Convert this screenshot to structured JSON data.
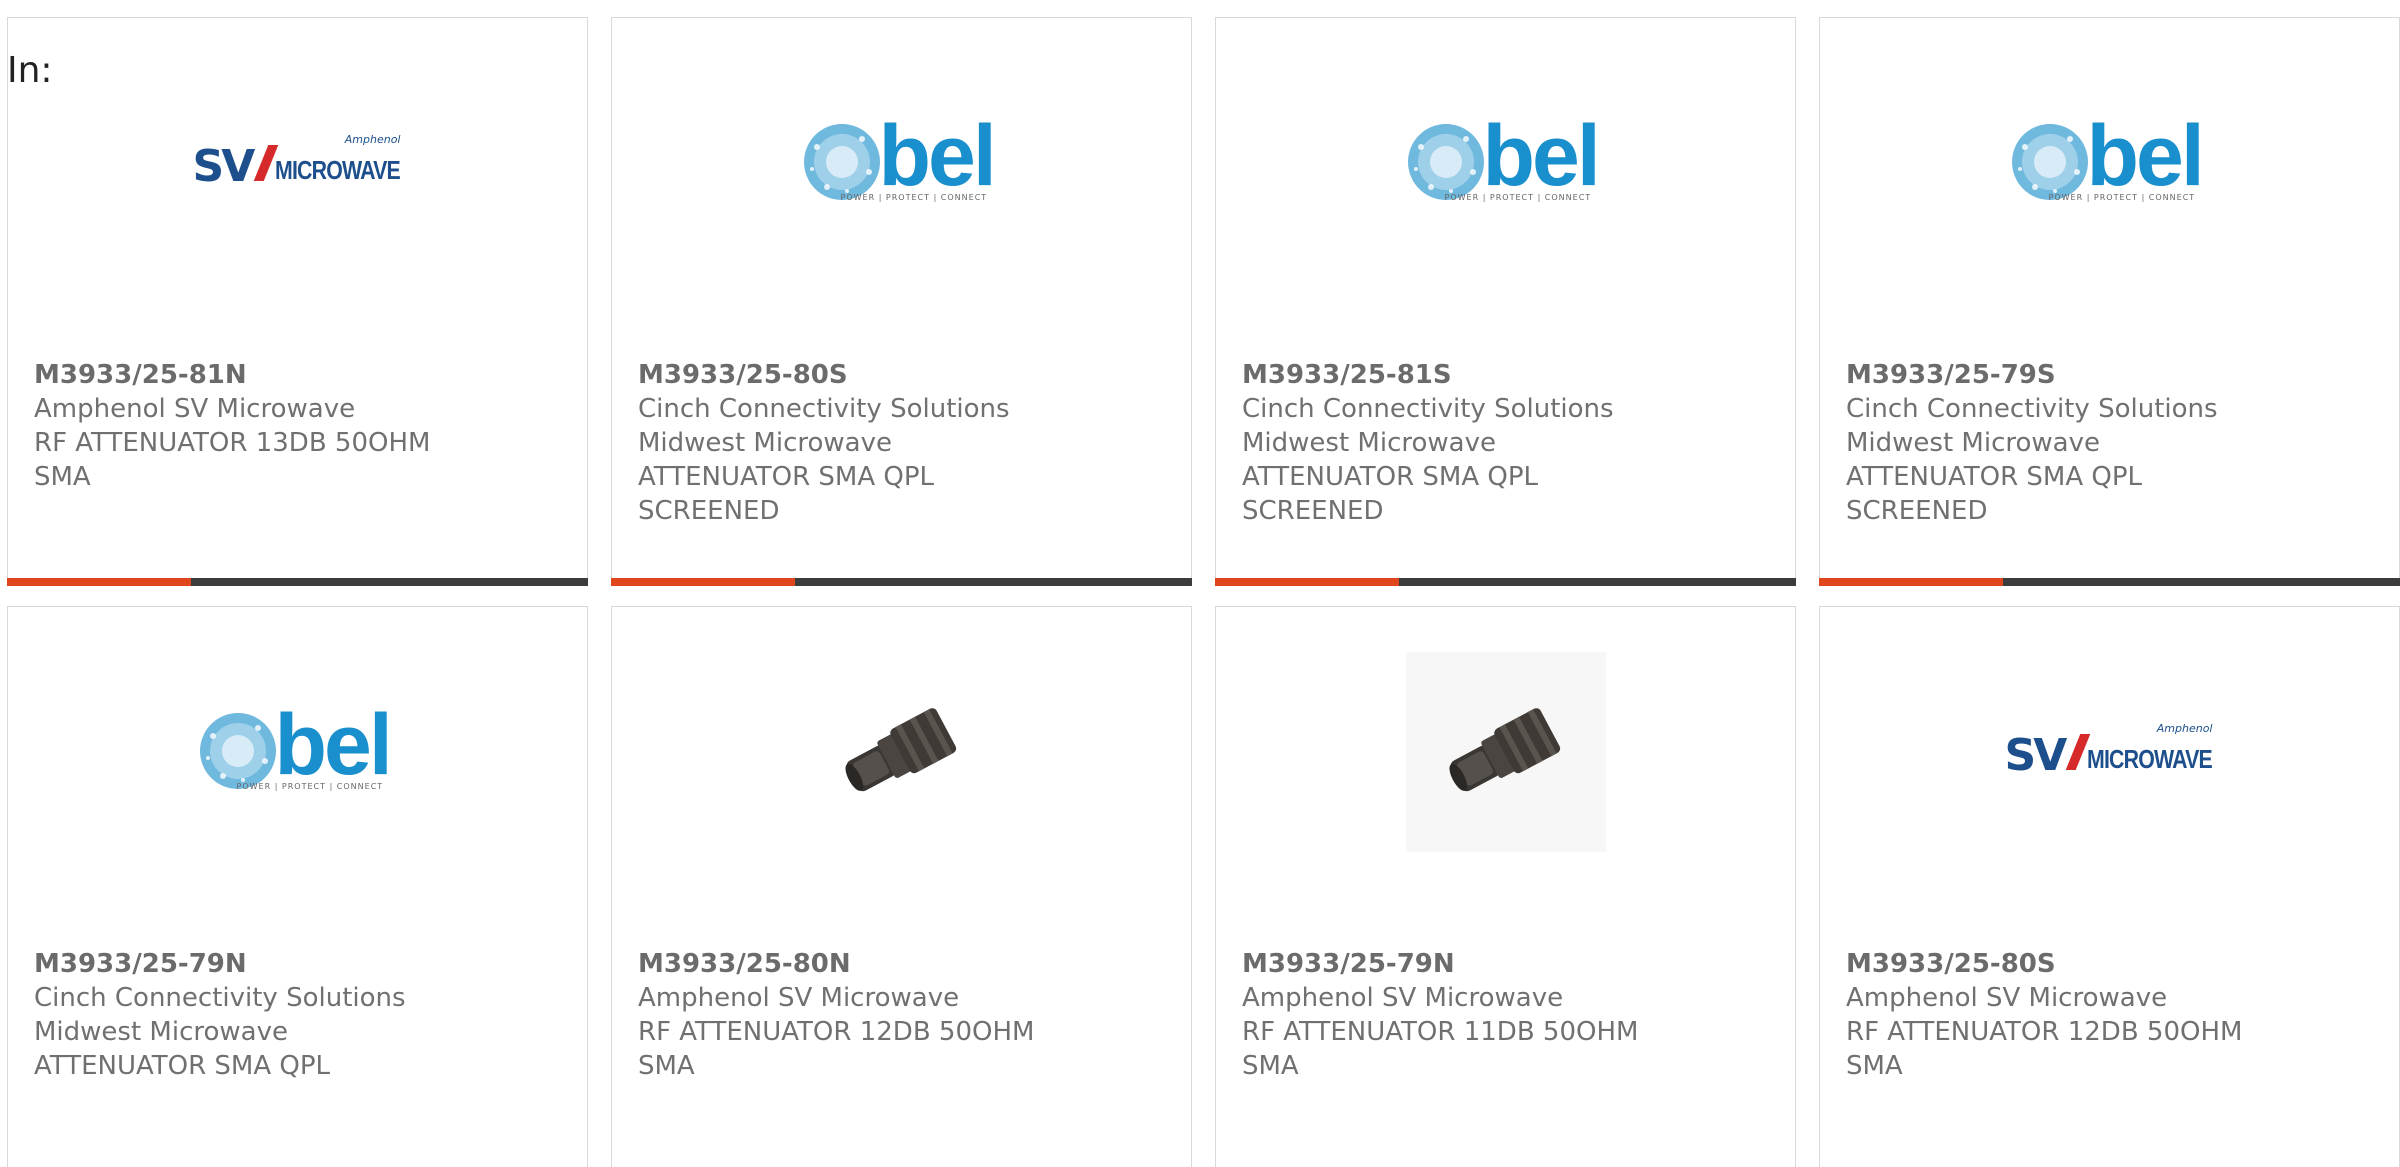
{
  "filter": {
    "label": "In:"
  },
  "products": [
    {
      "part_number": "M3933/25-81N",
      "manufacturer": "Amphenol SV Microwave",
      "description_lines": [
        "RF ATTENUATOR 13DB 50OHM",
        "SMA"
      ],
      "image": "sv-microwave-logo"
    },
    {
      "part_number": "M3933/25-80S",
      "manufacturer": "Cinch Connectivity Solutions",
      "description_lines": [
        "Midwest Microwave",
        "ATTENUATOR SMA QPL",
        "SCREENED"
      ],
      "image": "bel-logo"
    },
    {
      "part_number": "M3933/25-81S",
      "manufacturer": "Cinch Connectivity Solutions",
      "description_lines": [
        "Midwest Microwave",
        "ATTENUATOR SMA QPL",
        "SCREENED"
      ],
      "image": "bel-logo"
    },
    {
      "part_number": "M3933/25-79S",
      "manufacturer": "Cinch Connectivity Solutions",
      "description_lines": [
        "Midwest Microwave",
        "ATTENUATOR SMA QPL",
        "SCREENED"
      ],
      "image": "bel-logo"
    },
    {
      "part_number": "M3933/25-79N",
      "manufacturer": "Cinch Connectivity Solutions",
      "description_lines": [
        "Midwest Microwave",
        "ATTENUATOR SMA QPL"
      ],
      "image": "bel-logo"
    },
    {
      "part_number": "M3933/25-80N",
      "manufacturer": "Amphenol SV Microwave",
      "description_lines": [
        "RF ATTENUATOR 12DB 50OHM",
        "SMA"
      ],
      "image": "attenuator-photo"
    },
    {
      "part_number": "M3933/25-79N",
      "manufacturer": "Amphenol SV Microwave",
      "description_lines": [
        "RF ATTENUATOR 11DB 50OHM",
        "SMA"
      ],
      "image": "attenuator-photo"
    },
    {
      "part_number": "M3933/25-80S",
      "manufacturer": "Amphenol SV Microwave",
      "description_lines": [
        "RF ATTENUATOR 12DB 50OHM",
        "SMA"
      ],
      "image": "sv-microwave-logo"
    }
  ],
  "logos": {
    "sv_microwave": {
      "brand_small": "Amphenol",
      "letters": "SV",
      "word": "MICROWAVE"
    },
    "bel": {
      "word": "bel",
      "tagline": "POWER | PROTECT | CONNECT"
    }
  },
  "colors": {
    "accent": "#e0461d",
    "bar": "#3c3c3c",
    "text": "#707070",
    "sv_blue": "#1d4f8c",
    "bel_blue": "#1a8fce"
  }
}
